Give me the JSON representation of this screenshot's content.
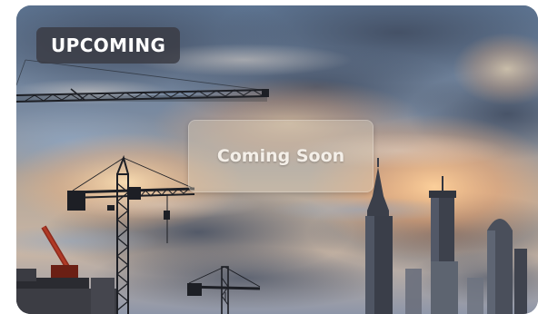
{
  "card": {
    "status_badge": "UPCOMING",
    "overlay_text": "Coming Soon",
    "image_subject": "construction-cranes-city-skyline-at-sunset"
  },
  "colors": {
    "badge_background": "#3a3c44",
    "badge_text": "#ffffff",
    "overlay_background": "#d6cab8",
    "overlay_text": "#f4efe8",
    "sky_top": "#5f7795",
    "sky_glow": "#f0b07a"
  }
}
